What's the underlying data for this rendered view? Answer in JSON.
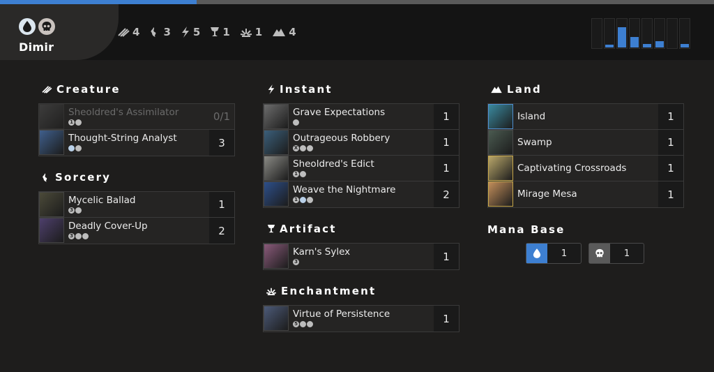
{
  "progress": {
    "fraction": 0.275
  },
  "deck": {
    "name": "Dimir",
    "colors": [
      "blue-mana-icon",
      "black-mana-icon"
    ]
  },
  "type_counts": [
    {
      "icon": "creature-icon",
      "count": "4"
    },
    {
      "icon": "sorcery-icon",
      "count": "3"
    },
    {
      "icon": "instant-icon",
      "count": "5"
    },
    {
      "icon": "artifact-icon",
      "count": "1"
    },
    {
      "icon": "enchantment-icon",
      "count": "1"
    },
    {
      "icon": "land-icon",
      "count": "4"
    }
  ],
  "mana_curve": {
    "levels": [
      0,
      0.1,
      0.7,
      0.35,
      0.12,
      0.22,
      0,
      0.12
    ],
    "color": "#3d7fd1"
  },
  "sections": {
    "creature": {
      "title": "Creature",
      "cards": [
        {
          "name": "Sheoldred's Assimilator",
          "qty": "0/1",
          "cost": [
            "1",
            "b"
          ],
          "art": "#5a5a5a"
        },
        {
          "name": "Thought-String Analyst",
          "qty": "3",
          "cost": [
            "u",
            "b"
          ],
          "art": "#3f5f8c"
        }
      ]
    },
    "sorcery": {
      "title": "Sorcery",
      "cards": [
        {
          "name": "Mycelic Ballad",
          "qty": "1",
          "cost": [
            "3",
            "b"
          ],
          "art": "#4b4a39"
        },
        {
          "name": "Deadly Cover-Up",
          "qty": "2",
          "cost": [
            "3",
            "b",
            "b"
          ],
          "art": "#4d3f6b"
        }
      ]
    },
    "instant": {
      "title": "Instant",
      "cards": [
        {
          "name": "Grave Expectations",
          "qty": "1",
          "cost": [
            "b"
          ],
          "art": "#6c6c6c"
        },
        {
          "name": "Outrageous Robbery",
          "qty": "1",
          "cost": [
            "X",
            "b",
            "b"
          ],
          "art": "#3b5f7a"
        },
        {
          "name": "Sheoldred's Edict",
          "qty": "1",
          "cost": [
            "1",
            "b"
          ],
          "art": "#8a8a85"
        },
        {
          "name": "Weave the Nightmare",
          "qty": "2",
          "cost": [
            "1",
            "u",
            "b"
          ],
          "art": "#2d4f8a"
        }
      ]
    },
    "artifact": {
      "title": "Artifact",
      "cards": [
        {
          "name": "Karn's Sylex",
          "qty": "1",
          "cost": [
            "3"
          ],
          "art": "#8a5a7a"
        }
      ]
    },
    "enchantment": {
      "title": "Enchantment",
      "cards": [
        {
          "name": "Virtue of Persistence",
          "qty": "1",
          "cost": [
            "5",
            "b",
            "b"
          ],
          "art": "#4c5a78"
        }
      ]
    },
    "land": {
      "title": "Land",
      "cards": [
        {
          "name": "Island",
          "qty": "1",
          "cost": [],
          "art": "#3a8aa0",
          "border": "#4f8fd0"
        },
        {
          "name": "Swamp",
          "qty": "1",
          "cost": [],
          "art": "#4a5a50",
          "border": "#4a4a4a"
        },
        {
          "name": "Captivating Crossroads",
          "qty": "1",
          "cost": [],
          "art": "#b9a76a",
          "border": "#c8a84a"
        },
        {
          "name": "Mirage Mesa",
          "qty": "1",
          "cost": [],
          "art": "#c28e5a",
          "border": "#c8a84a"
        }
      ]
    }
  },
  "mana_base": {
    "title": "Mana Base",
    "items": [
      {
        "icon": "blue-mana-icon",
        "count": "1",
        "color": "#3d7fd1"
      },
      {
        "icon": "black-mana-icon",
        "count": "1",
        "color": "#5a5a5a"
      }
    ]
  }
}
